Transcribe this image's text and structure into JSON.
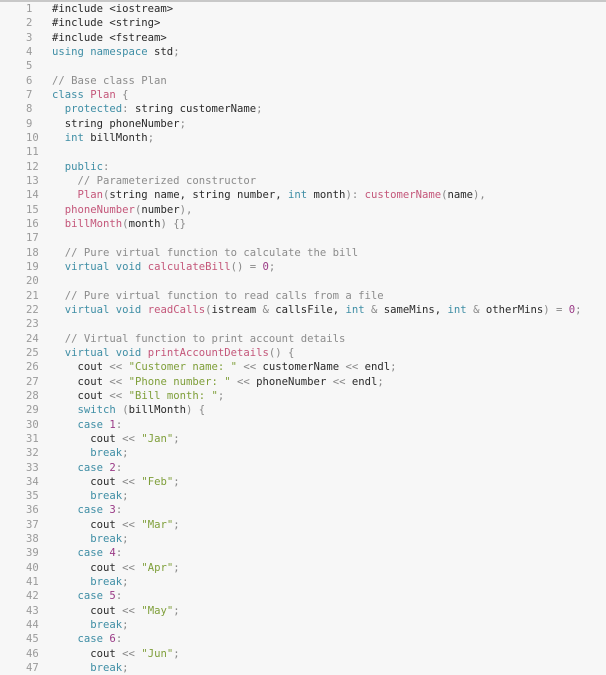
{
  "editor": {
    "language": "cpp",
    "colors": {
      "keyword": "#3f8ea5",
      "function": "#c4577a",
      "string": "#7f9f3a",
      "number": "#9a3a86",
      "comment": "#8c8c8c",
      "plain": "#2b2b2b",
      "line_number": "#9a9a9a",
      "background": "#f7f7f7"
    },
    "lines": [
      {
        "n": "1",
        "tokens": [
          [
            "pl",
            "#include <iostream>"
          ]
        ]
      },
      {
        "n": "2",
        "tokens": [
          [
            "pl",
            "#include <string>"
          ]
        ]
      },
      {
        "n": "3",
        "tokens": [
          [
            "pl",
            "#include <fstream>"
          ]
        ]
      },
      {
        "n": "4",
        "tokens": [
          [
            "kw",
            "using namespace"
          ],
          [
            "pl",
            " std"
          ],
          [
            "op",
            ";"
          ]
        ]
      },
      {
        "n": "5",
        "tokens": []
      },
      {
        "n": "6",
        "tokens": [
          [
            "cm",
            "// Base class Plan"
          ]
        ]
      },
      {
        "n": "7",
        "tokens": [
          [
            "kw",
            "class"
          ],
          [
            "pl",
            " "
          ],
          [
            "fn",
            "Plan"
          ],
          [
            "op",
            " {"
          ]
        ]
      },
      {
        "n": "8",
        "tokens": [
          [
            "pl",
            "  "
          ],
          [
            "kw",
            "protected"
          ],
          [
            "op",
            ":"
          ],
          [
            "pl",
            " string customerName"
          ],
          [
            "op",
            ";"
          ]
        ]
      },
      {
        "n": "9",
        "tokens": [
          [
            "pl",
            "  string phoneNumber"
          ],
          [
            "op",
            ";"
          ]
        ]
      },
      {
        "n": "10",
        "tokens": [
          [
            "pl",
            "  "
          ],
          [
            "kw",
            "int"
          ],
          [
            "pl",
            " billMonth"
          ],
          [
            "op",
            ";"
          ]
        ]
      },
      {
        "n": "11",
        "tokens": []
      },
      {
        "n": "12",
        "tokens": [
          [
            "pl",
            "  "
          ],
          [
            "kw",
            "public"
          ],
          [
            "op",
            ":"
          ]
        ]
      },
      {
        "n": "13",
        "tokens": [
          [
            "pl",
            "    "
          ],
          [
            "cm",
            "// Parameterized constructor"
          ]
        ]
      },
      {
        "n": "14",
        "tokens": [
          [
            "pl",
            "    "
          ],
          [
            "fn",
            "Plan"
          ],
          [
            "op",
            "("
          ],
          [
            "pl",
            "string name, string number, "
          ],
          [
            "kw",
            "int"
          ],
          [
            "pl",
            " month"
          ],
          [
            "op",
            "): "
          ],
          [
            "fn",
            "customerName"
          ],
          [
            "op",
            "("
          ],
          [
            "pl",
            "name"
          ],
          [
            "op",
            "),"
          ]
        ]
      },
      {
        "n": "15",
        "tokens": [
          [
            "pl",
            "  "
          ],
          [
            "fn",
            "phoneNumber"
          ],
          [
            "op",
            "("
          ],
          [
            "pl",
            "number"
          ],
          [
            "op",
            "),"
          ]
        ]
      },
      {
        "n": "16",
        "tokens": [
          [
            "pl",
            "  "
          ],
          [
            "fn",
            "billMonth"
          ],
          [
            "op",
            "("
          ],
          [
            "pl",
            "month"
          ],
          [
            "op",
            ") {}"
          ]
        ]
      },
      {
        "n": "17",
        "tokens": []
      },
      {
        "n": "18",
        "tokens": [
          [
            "pl",
            "  "
          ],
          [
            "cm",
            "// Pure virtual function to calculate the bill"
          ]
        ]
      },
      {
        "n": "19",
        "tokens": [
          [
            "pl",
            "  "
          ],
          [
            "kw",
            "virtual void"
          ],
          [
            "pl",
            " "
          ],
          [
            "fn",
            "calculateBill"
          ],
          [
            "op",
            "() = "
          ],
          [
            "num",
            "0"
          ],
          [
            "op",
            ";"
          ]
        ]
      },
      {
        "n": "20",
        "tokens": []
      },
      {
        "n": "21",
        "tokens": [
          [
            "pl",
            "  "
          ],
          [
            "cm",
            "// Pure virtual function to read calls from a file"
          ]
        ]
      },
      {
        "n": "22",
        "tokens": [
          [
            "pl",
            "  "
          ],
          [
            "kw",
            "virtual void"
          ],
          [
            "pl",
            " "
          ],
          [
            "fn",
            "readCalls"
          ],
          [
            "op",
            "("
          ],
          [
            "pl",
            "istream "
          ],
          [
            "op",
            "&"
          ],
          [
            "pl",
            " callsFile, "
          ],
          [
            "kw",
            "int"
          ],
          [
            "op",
            " &"
          ],
          [
            "pl",
            " sameMins, "
          ],
          [
            "kw",
            "int"
          ],
          [
            "op",
            " &"
          ],
          [
            "pl",
            " otherMins"
          ],
          [
            "op",
            ") = "
          ],
          [
            "num",
            "0"
          ],
          [
            "op",
            ";"
          ]
        ]
      },
      {
        "n": "23",
        "tokens": []
      },
      {
        "n": "24",
        "tokens": [
          [
            "pl",
            "  "
          ],
          [
            "cm",
            "// Virtual function to print account details"
          ]
        ]
      },
      {
        "n": "25",
        "tokens": [
          [
            "pl",
            "  "
          ],
          [
            "kw",
            "virtual void"
          ],
          [
            "pl",
            " "
          ],
          [
            "fn",
            "printAccountDetails"
          ],
          [
            "op",
            "() {"
          ]
        ]
      },
      {
        "n": "26",
        "tokens": [
          [
            "pl",
            "    cout "
          ],
          [
            "op",
            "<<"
          ],
          [
            "pl",
            " "
          ],
          [
            "str",
            "\"Customer name: \""
          ],
          [
            "pl",
            " "
          ],
          [
            "op",
            "<<"
          ],
          [
            "pl",
            " customerName "
          ],
          [
            "op",
            "<<"
          ],
          [
            "pl",
            " endl"
          ],
          [
            "op",
            ";"
          ]
        ]
      },
      {
        "n": "27",
        "tokens": [
          [
            "pl",
            "    cout "
          ],
          [
            "op",
            "<<"
          ],
          [
            "pl",
            " "
          ],
          [
            "str",
            "\"Phone number: \""
          ],
          [
            "pl",
            " "
          ],
          [
            "op",
            "<<"
          ],
          [
            "pl",
            " phoneNumber "
          ],
          [
            "op",
            "<<"
          ],
          [
            "pl",
            " endl"
          ],
          [
            "op",
            ";"
          ]
        ]
      },
      {
        "n": "28",
        "tokens": [
          [
            "pl",
            "    cout "
          ],
          [
            "op",
            "<<"
          ],
          [
            "pl",
            " "
          ],
          [
            "str",
            "\"Bill month: \""
          ],
          [
            "op",
            ";"
          ]
        ]
      },
      {
        "n": "29",
        "tokens": [
          [
            "pl",
            "    "
          ],
          [
            "kw",
            "switch"
          ],
          [
            "pl",
            " "
          ],
          [
            "op",
            "("
          ],
          [
            "pl",
            "billMonth"
          ],
          [
            "op",
            ") {"
          ]
        ]
      },
      {
        "n": "30",
        "tokens": [
          [
            "pl",
            "    "
          ],
          [
            "kw",
            "case"
          ],
          [
            "pl",
            " "
          ],
          [
            "num",
            "1"
          ],
          [
            "op",
            ":"
          ]
        ]
      },
      {
        "n": "31",
        "tokens": [
          [
            "pl",
            "      cout "
          ],
          [
            "op",
            "<<"
          ],
          [
            "pl",
            " "
          ],
          [
            "str",
            "\"Jan\""
          ],
          [
            "op",
            ";"
          ]
        ]
      },
      {
        "n": "32",
        "tokens": [
          [
            "pl",
            "      "
          ],
          [
            "kw",
            "break"
          ],
          [
            "op",
            ";"
          ]
        ]
      },
      {
        "n": "33",
        "tokens": [
          [
            "pl",
            "    "
          ],
          [
            "kw",
            "case"
          ],
          [
            "pl",
            " "
          ],
          [
            "num",
            "2"
          ],
          [
            "op",
            ":"
          ]
        ]
      },
      {
        "n": "34",
        "tokens": [
          [
            "pl",
            "      cout "
          ],
          [
            "op",
            "<<"
          ],
          [
            "pl",
            " "
          ],
          [
            "str",
            "\"Feb\""
          ],
          [
            "op",
            ";"
          ]
        ]
      },
      {
        "n": "35",
        "tokens": [
          [
            "pl",
            "      "
          ],
          [
            "kw",
            "break"
          ],
          [
            "op",
            ";"
          ]
        ]
      },
      {
        "n": "36",
        "tokens": [
          [
            "pl",
            "    "
          ],
          [
            "kw",
            "case"
          ],
          [
            "pl",
            " "
          ],
          [
            "num",
            "3"
          ],
          [
            "op",
            ":"
          ]
        ]
      },
      {
        "n": "37",
        "tokens": [
          [
            "pl",
            "      cout "
          ],
          [
            "op",
            "<<"
          ],
          [
            "pl",
            " "
          ],
          [
            "str",
            "\"Mar\""
          ],
          [
            "op",
            ";"
          ]
        ]
      },
      {
        "n": "38",
        "tokens": [
          [
            "pl",
            "      "
          ],
          [
            "kw",
            "break"
          ],
          [
            "op",
            ";"
          ]
        ]
      },
      {
        "n": "39",
        "tokens": [
          [
            "pl",
            "    "
          ],
          [
            "kw",
            "case"
          ],
          [
            "pl",
            " "
          ],
          [
            "num",
            "4"
          ],
          [
            "op",
            ":"
          ]
        ]
      },
      {
        "n": "40",
        "tokens": [
          [
            "pl",
            "      cout "
          ],
          [
            "op",
            "<<"
          ],
          [
            "pl",
            " "
          ],
          [
            "str",
            "\"Apr\""
          ],
          [
            "op",
            ";"
          ]
        ]
      },
      {
        "n": "41",
        "tokens": [
          [
            "pl",
            "      "
          ],
          [
            "kw",
            "break"
          ],
          [
            "op",
            ";"
          ]
        ]
      },
      {
        "n": "42",
        "tokens": [
          [
            "pl",
            "    "
          ],
          [
            "kw",
            "case"
          ],
          [
            "pl",
            " "
          ],
          [
            "num",
            "5"
          ],
          [
            "op",
            ":"
          ]
        ]
      },
      {
        "n": "43",
        "tokens": [
          [
            "pl",
            "      cout "
          ],
          [
            "op",
            "<<"
          ],
          [
            "pl",
            " "
          ],
          [
            "str",
            "\"May\""
          ],
          [
            "op",
            ";"
          ]
        ]
      },
      {
        "n": "44",
        "tokens": [
          [
            "pl",
            "      "
          ],
          [
            "kw",
            "break"
          ],
          [
            "op",
            ";"
          ]
        ]
      },
      {
        "n": "45",
        "tokens": [
          [
            "pl",
            "    "
          ],
          [
            "kw",
            "case"
          ],
          [
            "pl",
            " "
          ],
          [
            "num",
            "6"
          ],
          [
            "op",
            ":"
          ]
        ]
      },
      {
        "n": "46",
        "tokens": [
          [
            "pl",
            "      cout "
          ],
          [
            "op",
            "<<"
          ],
          [
            "pl",
            " "
          ],
          [
            "str",
            "\"Jun\""
          ],
          [
            "op",
            ";"
          ]
        ]
      },
      {
        "n": "47",
        "tokens": [
          [
            "pl",
            "      "
          ],
          [
            "kw",
            "break"
          ],
          [
            "op",
            ";"
          ]
        ]
      }
    ]
  }
}
